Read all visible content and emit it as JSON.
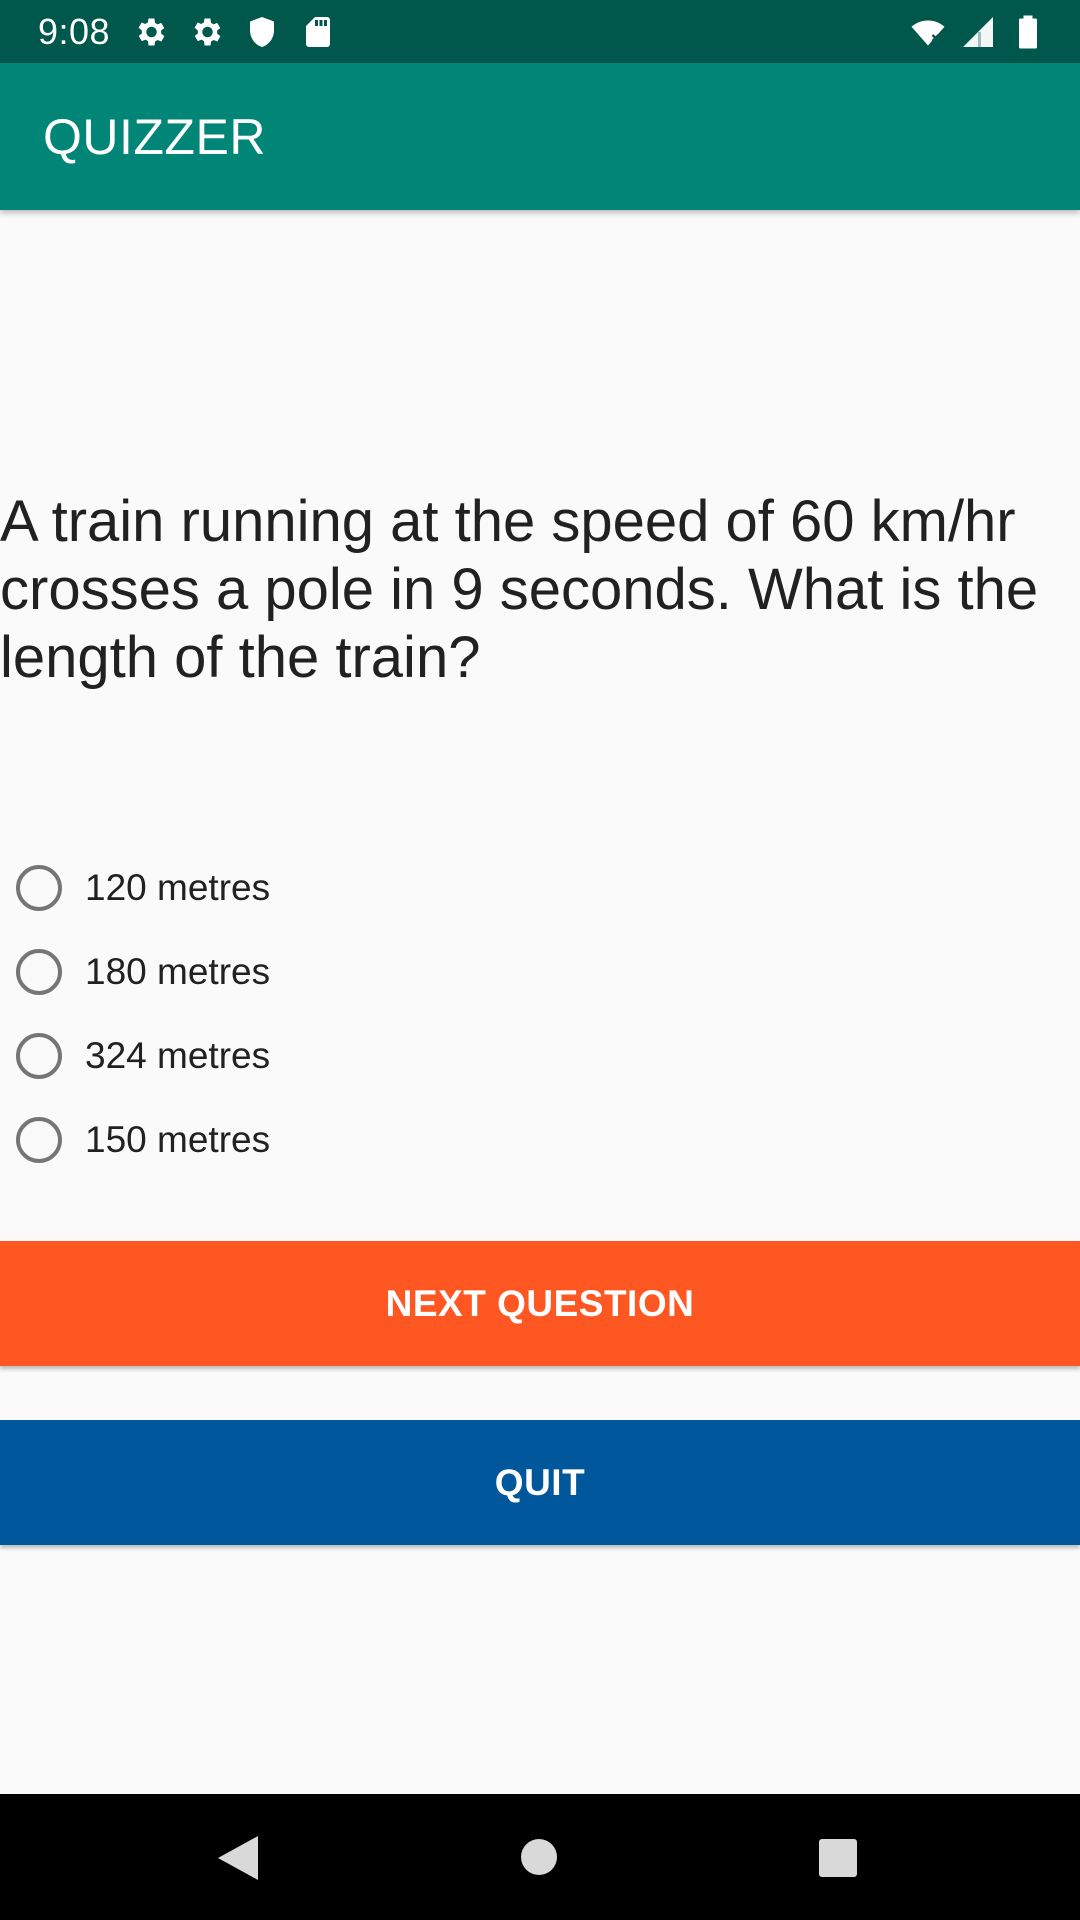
{
  "status_bar": {
    "time": "9:08",
    "left_icons": [
      "gear-icon",
      "gear-icon",
      "shield-icon",
      "sd-card-icon"
    ],
    "right_icons": [
      "wifi-icon",
      "signal-icon",
      "battery-icon"
    ]
  },
  "app_bar": {
    "title": "QUIZZER",
    "color": "#008577"
  },
  "question": {
    "text": "A train running at the speed of 60 km/hr crosses a pole in 9 seconds. What is the length of the train?"
  },
  "options": [
    {
      "label": "120 metres",
      "selected": false
    },
    {
      "label": "180 metres",
      "selected": false
    },
    {
      "label": "324 metres",
      "selected": false
    },
    {
      "label": "150 metres",
      "selected": false
    }
  ],
  "buttons": {
    "next_label": "NEXT QUESTION",
    "next_color": "#FF5722",
    "quit_label": "QUIT",
    "quit_color": "#01579B"
  },
  "nav_bar": {
    "icons": [
      "back-icon",
      "home-icon",
      "recents-icon"
    ]
  }
}
